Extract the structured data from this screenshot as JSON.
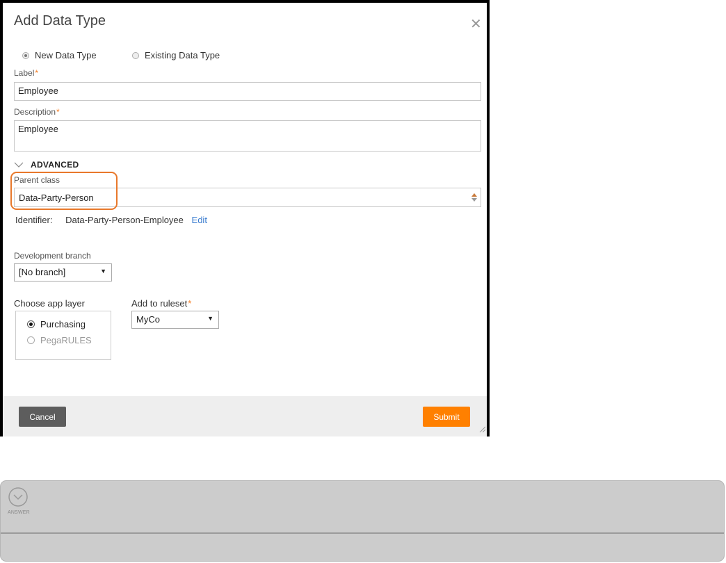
{
  "dialog": {
    "title": "Add Data Type",
    "close_icon": "close-icon",
    "type_options": [
      {
        "label": "New Data Type",
        "selected": true
      },
      {
        "label": "Existing Data Type",
        "selected": false
      }
    ],
    "label_field": {
      "label": "Label",
      "required_mark": "*",
      "value": "Employee"
    },
    "description_field": {
      "label": "Description",
      "required_mark": "*",
      "value": "Employee"
    },
    "advanced": {
      "heading": "ADVANCED",
      "icon": "chevron-down-icon"
    },
    "parent_class": {
      "label": "Parent class",
      "value": "Data-Party-Person"
    },
    "identifier": {
      "label": "Identifier:",
      "value": "Data-Party-Person-Employee",
      "edit_label": "Edit"
    },
    "development_branch": {
      "label": "Development branch",
      "value": "[No branch]"
    },
    "app_layer": {
      "label": "Choose app layer",
      "options": [
        {
          "label": "Purchasing",
          "selected": true
        },
        {
          "label": "PegaRULES",
          "selected": false
        }
      ]
    },
    "ruleset": {
      "label": "Add to ruleset",
      "required_mark": "*",
      "value": "MyCo"
    },
    "buttons": {
      "cancel": "Cancel",
      "submit": "Submit"
    }
  },
  "answer_panel": {
    "label": "ANSWER",
    "icon": "chevron-down-circle-icon"
  },
  "colors": {
    "accent": "#ff8000",
    "highlight": "#e8782b",
    "link": "#3a7ccf"
  }
}
